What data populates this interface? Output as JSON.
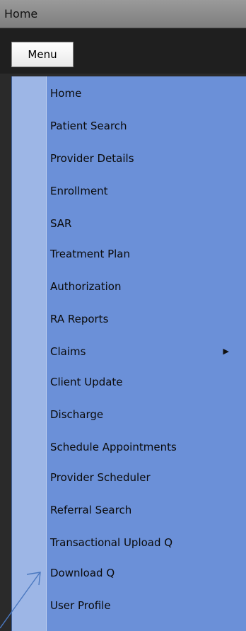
{
  "window": {
    "title": "Home"
  },
  "menubar": {
    "menu_label": "Menu"
  },
  "menu": {
    "items": [
      {
        "label": "Home"
      },
      {
        "label": "Patient Search"
      },
      {
        "label": "Provider Details"
      },
      {
        "label": "Enrollment"
      },
      {
        "label": "SAR"
      },
      {
        "label": "Treatment Plan"
      },
      {
        "label": "Authorization"
      },
      {
        "label": "RA Reports"
      },
      {
        "label": "Claims",
        "has_submenu": true,
        "submenu_icon": "chevron-right-icon"
      },
      {
        "label": "Client Update"
      },
      {
        "label": "Discharge"
      },
      {
        "label": "Schedule Appointments"
      },
      {
        "label": "Provider Scheduler"
      },
      {
        "label": "Referral Search"
      },
      {
        "label": "Transactional Upload Q"
      },
      {
        "label": "Download Q"
      },
      {
        "label": "User Profile"
      }
    ]
  },
  "annotation": {
    "icon": "arrow-pointer-icon",
    "target": "Download Q",
    "color": "#4a78c0"
  },
  "colors": {
    "titlebar": "#8c8c8c",
    "menubar": "#1f1f1f",
    "menu_panel": "#6b90d8",
    "menu_gutter": "#9db6e6"
  }
}
